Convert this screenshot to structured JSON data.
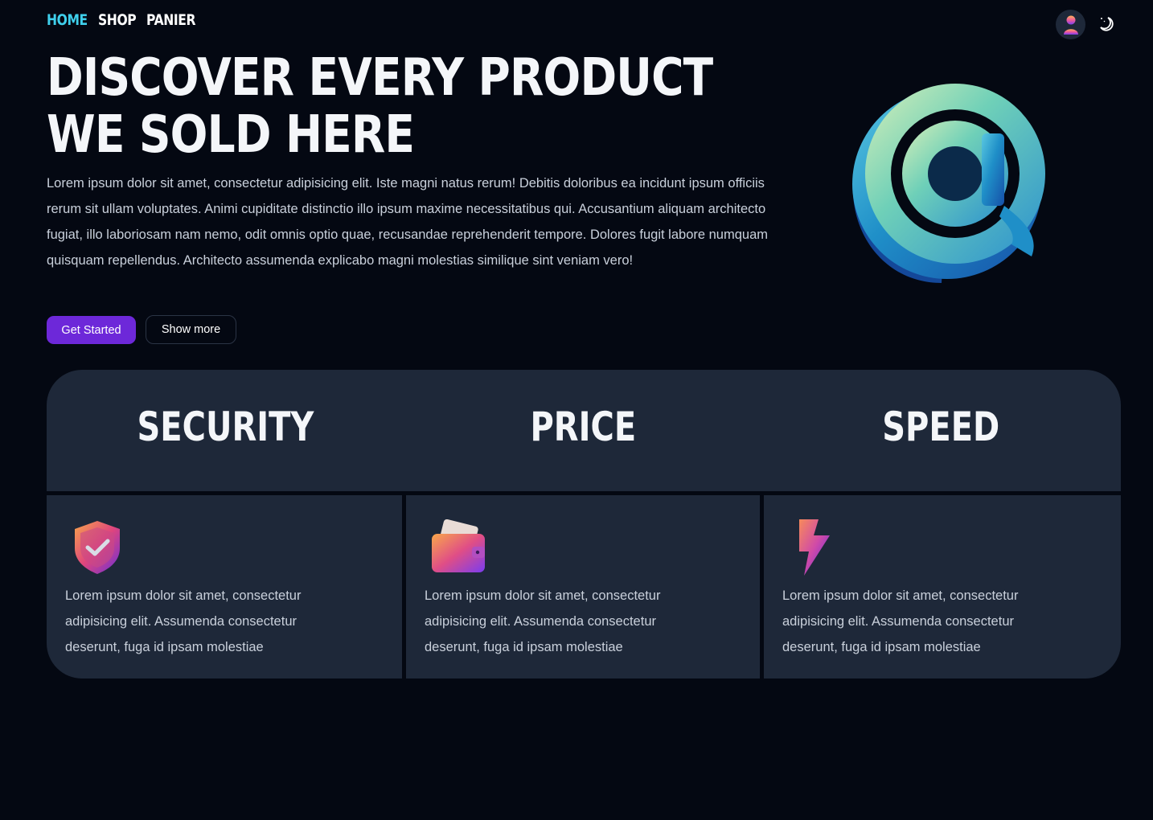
{
  "nav": {
    "items": [
      "HOME",
      "SHOP",
      "PANIER"
    ],
    "active": "HOME"
  },
  "hero": {
    "title": "DISCOVER EVERY PRODUCT WE SOLD HERE",
    "text": "Lorem ipsum dolor sit amet, consectetur adipisicing elit. Iste magni natus rerum! Debitis doloribus ea incidunt ipsum officiis rerum sit ullam voluptates. Animi cupiditate distinctio illo ipsum maxime necessitatibus qui. Accusantium aliquam architecto fugiat, illo laboriosam nam nemo, odit omnis optio quae, recusandae reprehenderit tempore. Dolores fugit labore numquam quisquam repellendus. Architecto assumenda explicabo magni molestias similique sint veniam vero!",
    "primary_button": "Get Started",
    "secondary_button": "Show more"
  },
  "features": [
    {
      "title": "SECURITY",
      "icon": "shield-check-icon",
      "text": "Lorem ipsum dolor sit amet, consectetur adipisicing elit. Assumenda consectetur deserunt, fuga id ipsam molestiae"
    },
    {
      "title": "PRICE",
      "icon": "wallet-icon",
      "text": "Lorem ipsum dolor sit amet, consectetur adipisicing elit. Assumenda consectetur deserunt, fuga id ipsam molestiae"
    },
    {
      "title": "SPEED",
      "icon": "lightning-icon",
      "text": "Lorem ipsum dolor sit amet, consectetur adipisicing elit. Assumenda consectetur deserunt, fuga id ipsam molestiae"
    }
  ],
  "colors": {
    "background": "#040812",
    "panel": "#1e2839",
    "accent": "#6d28d9",
    "nav_active": "#3fd0ec"
  }
}
